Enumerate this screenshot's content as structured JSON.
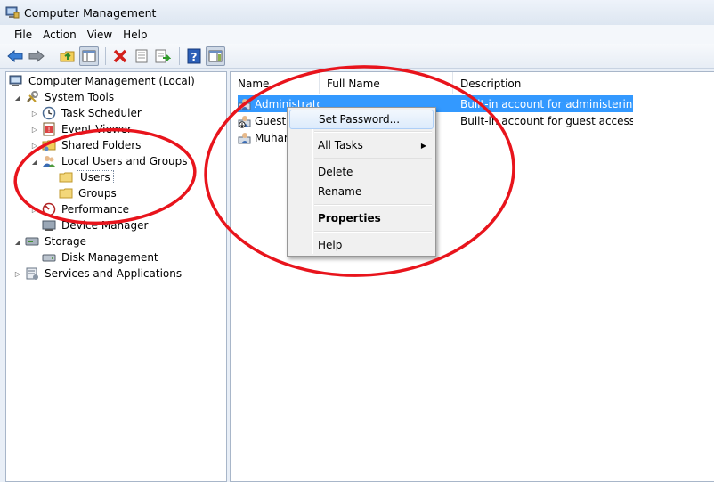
{
  "window": {
    "title": "Computer Management"
  },
  "menubar": {
    "items": [
      "File",
      "Action",
      "View",
      "Help"
    ]
  },
  "toolbar": {
    "buttons": [
      "back-icon",
      "forward-icon",
      "up-folder-icon",
      "show-hide-tree-icon",
      "delete-icon",
      "properties-icon",
      "export-list-icon",
      "help-icon",
      "show-action-pane-icon"
    ]
  },
  "tree": {
    "root": "Computer Management (Local)",
    "system_tools": "System Tools",
    "task_scheduler": "Task Scheduler",
    "event_viewer": "Event Viewer",
    "shared_folders": "Shared Folders",
    "local_users_groups": "Local Users and Groups",
    "users": "Users",
    "groups": "Groups",
    "performance": "Performance",
    "device_manager": "Device Manager",
    "storage": "Storage",
    "disk_management": "Disk Management",
    "services_apps": "Services and Applications"
  },
  "list": {
    "columns": {
      "name": "Name",
      "full_name": "Full Name",
      "description": "Description"
    },
    "rows": [
      {
        "name": "Administrator",
        "full_name": "",
        "description": "Built-in account for administering...",
        "selected": true
      },
      {
        "name": "Guest",
        "full_name": "",
        "description": "Built-in account for guest access t...",
        "selected": false
      },
      {
        "name": "Muhammad",
        "full_name": "",
        "description": "",
        "selected": false
      }
    ]
  },
  "context_menu": {
    "set_password": "Set Password...",
    "all_tasks": "All Tasks",
    "delete": "Delete",
    "rename": "Rename",
    "properties": "Properties",
    "help": "Help"
  },
  "colors": {
    "selection": "#3399ff",
    "annotation": "#e8141c"
  }
}
